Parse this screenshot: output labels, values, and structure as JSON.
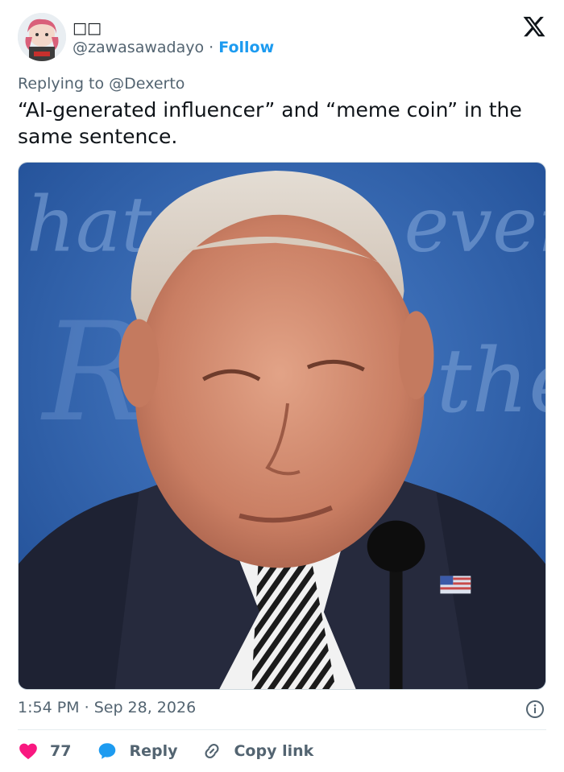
{
  "tweet": {
    "author_name": "□□",
    "handle": "@zawasawadayo",
    "separator": "·",
    "follow_label": "Follow",
    "replying_prefix": "Replying to",
    "replying_to": "@Dexerto",
    "text": "“AI-generated influencer” and “meme coin” in the same sentence.",
    "time": "1:54 PM",
    "date": "Sep 28, 2026",
    "like_count": "77",
    "reply_label": "Reply",
    "copy_link_label": "Copy link"
  },
  "colors": {
    "accent": "#1d9bf0",
    "like": "#f91880",
    "secondary_text": "#536471",
    "primary_text": "#0f1419"
  },
  "icons": {
    "logo": "x-logo-icon",
    "info": "info-icon",
    "like": "heart-icon",
    "reply": "reply-bubble-icon",
    "copy": "link-icon"
  }
}
